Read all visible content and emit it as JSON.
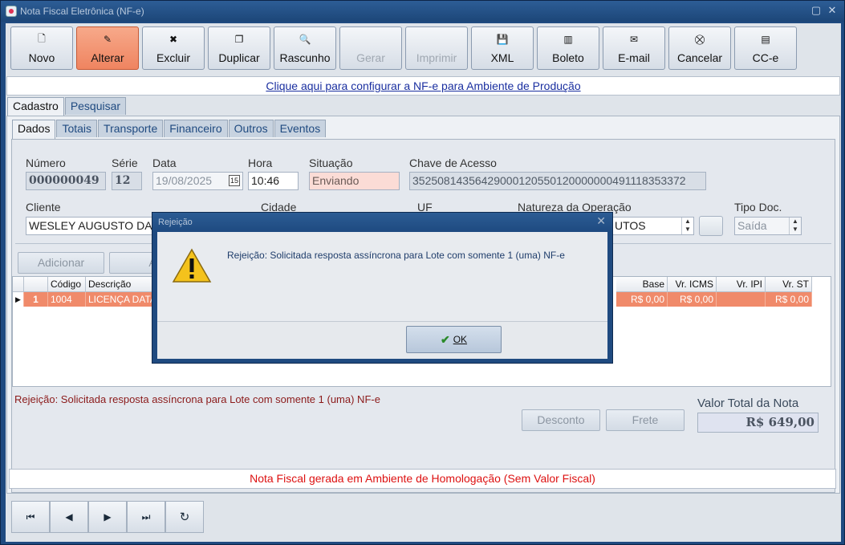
{
  "window": {
    "title": "Nota Fiscal Eletrônica (NF-e)"
  },
  "toolbar": [
    {
      "label": "Novo",
      "icon": "new-document-icon",
      "glyph": "🗋",
      "state": "normal"
    },
    {
      "label": "Alterar",
      "icon": "edit-icon",
      "glyph": "✎",
      "state": "active"
    },
    {
      "label": "Excluir",
      "icon": "delete-icon",
      "glyph": "✖",
      "state": "normal"
    },
    {
      "label": "Duplicar",
      "icon": "duplicate-icon",
      "glyph": "❐",
      "state": "normal"
    },
    {
      "label": "Rascunho",
      "icon": "draft-icon",
      "glyph": "🔍",
      "state": "normal"
    },
    {
      "label": "Gerar",
      "icon": "generate-icon",
      "glyph": "",
      "state": "disabled"
    },
    {
      "label": "Imprimir",
      "icon": "print-icon",
      "glyph": "",
      "state": "disabled"
    },
    {
      "label": "XML",
      "icon": "save-icon",
      "glyph": "💾",
      "state": "normal"
    },
    {
      "label": "Boleto",
      "icon": "barcode-icon",
      "glyph": "▥",
      "state": "normal"
    },
    {
      "label": "E-mail",
      "icon": "mail-icon",
      "glyph": "✉",
      "state": "normal"
    },
    {
      "label": "Cancelar",
      "icon": "cancel-icon",
      "glyph": "⛒",
      "state": "normal"
    },
    {
      "label": "CC-e",
      "icon": "cce-icon",
      "glyph": "▤",
      "state": "normal"
    }
  ],
  "config_link": "Clique aqui para configurar a NF-e para Ambiente de Produção",
  "main_tabs": [
    "Cadastro",
    "Pesquisar"
  ],
  "sub_tabs": [
    "Dados",
    "Totais",
    "Transporte",
    "Financeiro",
    "Outros",
    "Eventos"
  ],
  "form": {
    "numero_label": "Número",
    "numero": "000000049",
    "serie_label": "Série",
    "serie": "12",
    "data_label": "Data",
    "data": "19/08/2025",
    "hora_label": "Hora",
    "hora": "10:46",
    "situacao_label": "Situação",
    "situacao": "Enviando",
    "chave_label": "Chave de Acesso",
    "chave": "35250814356429000120550120000000491118353372",
    "cliente_label": "Cliente",
    "cliente": "WESLEY AUGUSTO DA",
    "cidade_label": "Cidade",
    "uf_label": "UF",
    "natureza_label": "Natureza da Operação",
    "natureza": "UTOS",
    "tipo_label": "Tipo Doc.",
    "tipo": "Saída"
  },
  "item_buttons": {
    "adicionar": "Adicionar",
    "second": "A"
  },
  "grid": {
    "headers": [
      "Código",
      "Descrição",
      "Base ICMS",
      "Vr. ICMS",
      "Vr. IPI",
      "Vr. ST"
    ],
    "row": {
      "n": "1",
      "codigo": "1004",
      "descricao": "LICENÇA DATA",
      "base_icms": "R$ 0,00",
      "vr_icms": "R$ 0,00",
      "vr_ipi": "",
      "vr_st": "R$ 0,00"
    }
  },
  "error_text": "Rejeição: Solicitada resposta assíncrona para Lote com somente 1 (uma) NF-e",
  "valor_total_label": "Valor Total da Nota",
  "valor_total": "R$ 649,00",
  "desconto_label": "Desconto",
  "frete_label": "Frete",
  "homologacao_text": "Nota Fiscal gerada em Ambiente de Homologação (Sem Valor Fiscal)",
  "nav": [
    "first-record-icon",
    "previous-record-icon",
    "next-record-icon",
    "last-record-icon",
    "refresh-icon"
  ],
  "dialog": {
    "title": "Rejeição",
    "message": "Rejeição: Solicitada resposta assíncrona para Lote com somente 1 (uma) NF-e",
    "ok_label": "OK"
  }
}
